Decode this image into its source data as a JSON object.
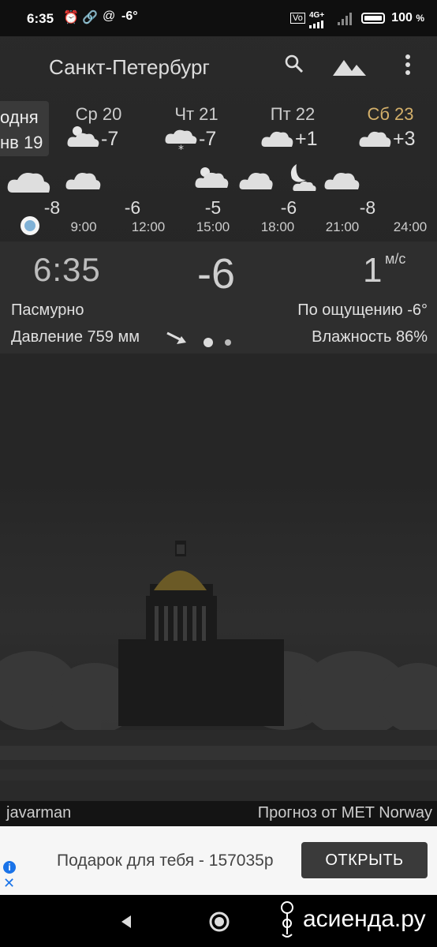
{
  "status_bar": {
    "time": "6:35",
    "temp": "-6°",
    "battery": "100",
    "battery_unit": "%",
    "network": "4G+"
  },
  "header": {
    "city": "Санкт-Петербург",
    "icons": [
      "search-icon",
      "landscape-icon",
      "more-vert-icon"
    ]
  },
  "days": {
    "today_line1": "одня",
    "today_line2": "нв 19",
    "items": [
      {
        "name": "Ср 20",
        "temp": "-7",
        "icon": "partly-cloudy-icon"
      },
      {
        "name": "Чт 21",
        "temp": "-7",
        "icon": "snow-icon"
      },
      {
        "name": "Пт 22",
        "temp": "+1",
        "icon": "cloud-icon"
      },
      {
        "name": "Сб 23",
        "temp": "+3",
        "icon": "cloud-icon",
        "color": "#d4b06a"
      }
    ]
  },
  "hourly": {
    "temps": [
      "-8",
      "-6",
      "-5",
      "-6",
      "-8"
    ],
    "times": [
      "9:00",
      "12:00",
      "15:00",
      "18:00",
      "21:00",
      "24:00"
    ]
  },
  "current": {
    "time": "6:35",
    "temp": "-6",
    "wind_speed": "1",
    "wind_unit": "м/с",
    "condition": "Пасмурно",
    "feels_like": "По ощущению -6°",
    "pressure": "Давление 759 мм",
    "humidity": "Влажность 86%"
  },
  "credits": {
    "author": "javarman",
    "source": "Прогноз от MET Norway"
  },
  "ad": {
    "text": "Подарок для тебя - 157035р",
    "button": "ОТКРЫТЬ"
  },
  "watermark": "асиенда.ру",
  "colors": {
    "accent_day": "#d4b06a",
    "now_dot": "#7fb1d6",
    "ad_button": "#3a3a3a"
  }
}
